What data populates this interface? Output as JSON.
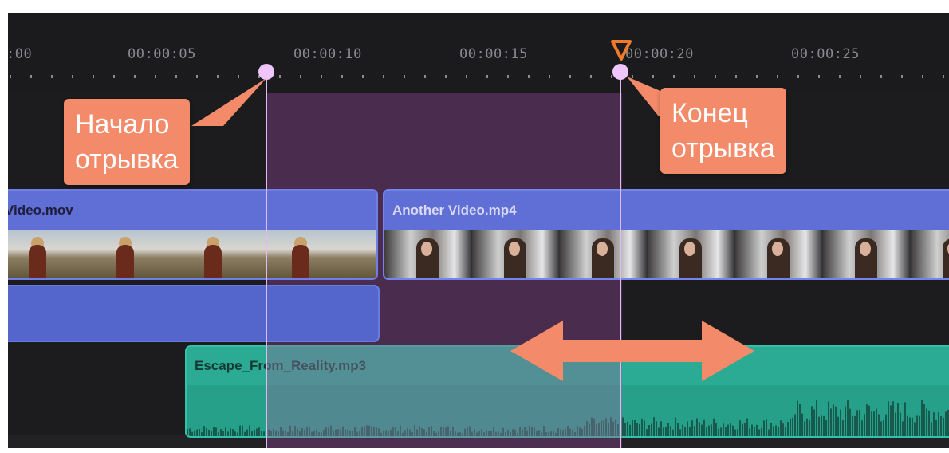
{
  "ruler": {
    "labels": [
      ":00",
      "00:00:05",
      "00:00:10",
      "00:00:15",
      "00:00:20",
      "00:00:25"
    ]
  },
  "tracks": {
    "video_clip_1": {
      "title": "Video.mov"
    },
    "video_clip_2": {
      "title": "Another Video.mp4"
    },
    "audio_clip": {
      "title": "Escape_From_Reality.mp3"
    }
  },
  "callouts": {
    "start": {
      "line1": "Начало",
      "line2": "отрывка"
    },
    "end": {
      "line1": "Конец",
      "line2": "отрывка"
    }
  },
  "colors": {
    "callout": "#f38b6a",
    "selection": "#703a76",
    "marker": "#f0c6fa",
    "video_clip": "#5f6fd6",
    "audio_clip": "#2bab94",
    "playhead": "#f07a2c"
  },
  "icons": {
    "playhead": "playhead-triangle-icon",
    "move_arrow": "double-arrow-icon"
  }
}
